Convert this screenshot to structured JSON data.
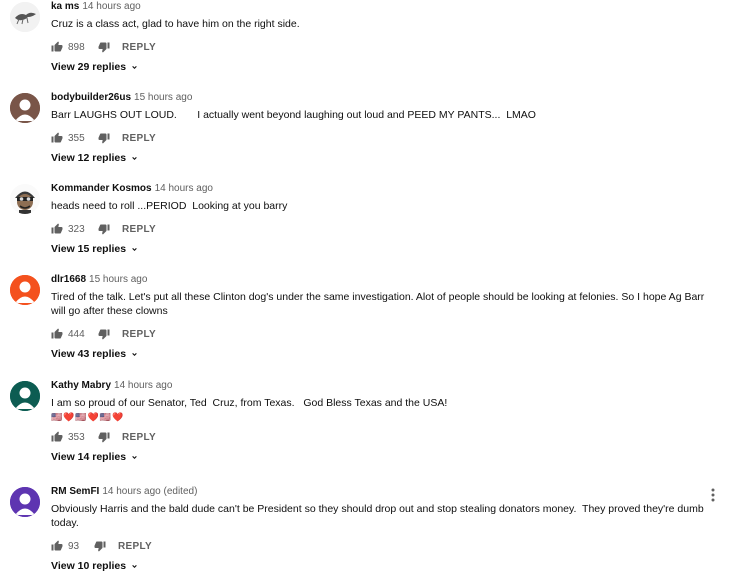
{
  "comments": [
    {
      "author": "ka ms",
      "time": "14 hours ago",
      "text": "Cruz is a class act, glad to have him on the right side.",
      "likes": "898",
      "reply_label": "REPLY",
      "view_replies": "View 29 replies",
      "avatar": "bird-sketch-avatar"
    },
    {
      "author": "bodybuilder26us",
      "time": "15 hours ago",
      "text": "Barr LAUGHS OUT LOUD.       I actually went beyond laughing out loud and PEED MY PANTS...  LMAO",
      "likes": "355",
      "reply_label": "REPLY",
      "view_replies": "View 12 replies",
      "avatar": "default-person-brown"
    },
    {
      "author": "Kommander Kosmos",
      "time": "14 hours ago",
      "text": "heads need to roll ...PERIOD  Looking at you barry",
      "likes": "323",
      "reply_label": "REPLY",
      "view_replies": "View 15 replies",
      "avatar": "helmet-soldier-avatar"
    },
    {
      "author": "dlr1668",
      "time": "15 hours ago",
      "text": "Tired of the talk. Let's put all these Clinton dog's under the same investigation. Alot of people should be looking at felonies. So I hope Ag Barr will go after these clowns",
      "likes": "444",
      "reply_label": "REPLY",
      "view_replies": "View 43 replies",
      "avatar": "default-person-orange"
    },
    {
      "author": "Kathy Mabry",
      "time": "14 hours ago",
      "text": "I am so proud of our Senator, Ted  Cruz, from Texas.   God Bless Texas and the USA!",
      "emoji": "🇺🇸❤️🇺🇸❤️🇺🇸❤️",
      "likes": "353",
      "reply_label": "REPLY",
      "view_replies": "View 14 replies",
      "avatar": "default-person-teal"
    },
    {
      "author": "RM SemFI",
      "time": "14 hours ago (edited)",
      "text": "Obviously Harris and the bald dude can't be President so they should drop out and stop stealing donators money.  They proved they're dumb today.",
      "likes": "93",
      "reply_label": "REPLY",
      "view_replies": "View 10 replies",
      "avatar": "default-person-purple"
    }
  ],
  "colors": {
    "text": "#0f0f0f",
    "secondary": "#606060",
    "avatar_brown": "#795548",
    "avatar_orange": "#f4511e",
    "avatar_teal": "#00695c",
    "avatar_purple": "#5e35b1"
  }
}
